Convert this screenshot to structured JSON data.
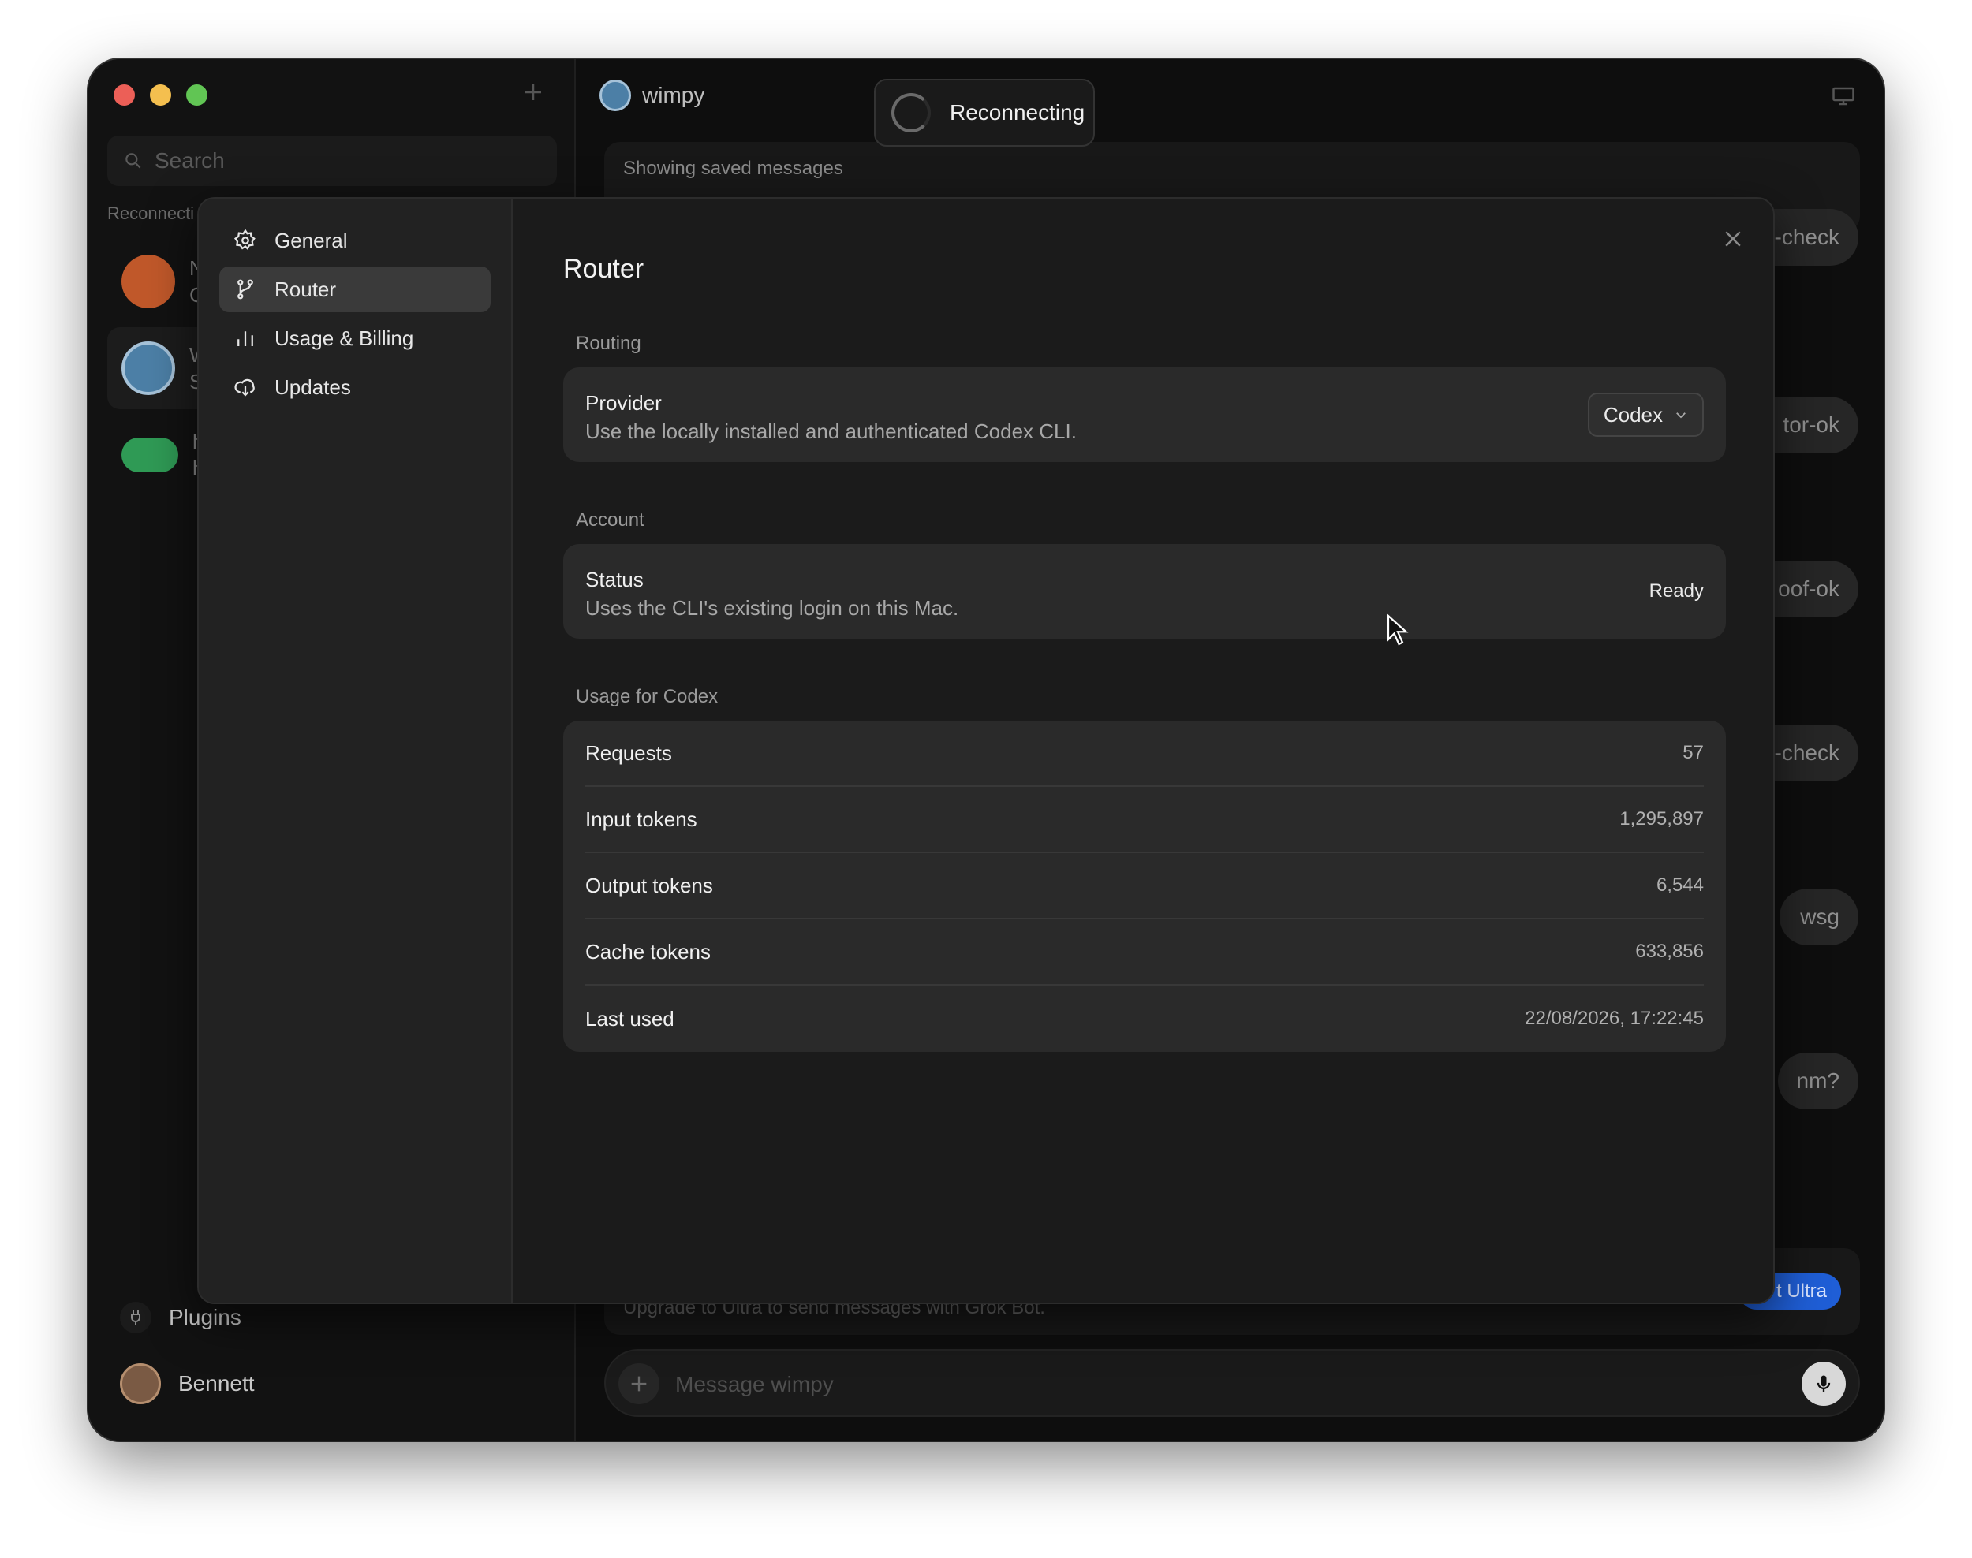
{
  "sidebar": {
    "search_placeholder": "Search",
    "section_label": "Reconnecti",
    "chats": [
      {
        "name": "N",
        "preview": "C"
      },
      {
        "name": "W",
        "preview": "S"
      },
      {
        "name": "h",
        "preview": "h"
      }
    ],
    "plugins_label": "Plugins",
    "user_name": "Bennett"
  },
  "chat": {
    "title": "wimpy",
    "reconnecting_label": "Reconnecting",
    "saved_banner": "Showing saved messages",
    "bubbles": [
      "-check",
      "tor-ok",
      "oof-ok",
      "-check",
      "wsg",
      "nm?"
    ],
    "upgrade_text": "Upgrade to Ultra to send messages with Grok Bot.",
    "ultra_button": "t Ultra",
    "composer_placeholder": "Message wimpy"
  },
  "settings": {
    "nav": [
      {
        "label": "General",
        "icon": "gear-icon"
      },
      {
        "label": "Router",
        "icon": "branch-icon"
      },
      {
        "label": "Usage & Billing",
        "icon": "bar-chart-icon"
      },
      {
        "label": "Updates",
        "icon": "cloud-download-icon"
      }
    ],
    "active_nav": "Router",
    "page_title": "Router",
    "routing": {
      "group_label": "Routing",
      "provider_title": "Provider",
      "provider_desc": "Use the locally installed and authenticated Codex CLI.",
      "provider_value": "Codex"
    },
    "account": {
      "group_label": "Account",
      "status_title": "Status",
      "status_desc": "Uses the CLI's existing login on this Mac.",
      "status_value": "Ready"
    },
    "usage": {
      "group_label": "Usage for Codex",
      "rows": [
        {
          "label": "Requests",
          "value": "57"
        },
        {
          "label": "Input tokens",
          "value": "1,295,897"
        },
        {
          "label": "Output tokens",
          "value": "6,544"
        },
        {
          "label": "Cache tokens",
          "value": "633,856"
        },
        {
          "label": "Last used",
          "value": "22/08/2026, 17:22:45"
        }
      ]
    }
  }
}
